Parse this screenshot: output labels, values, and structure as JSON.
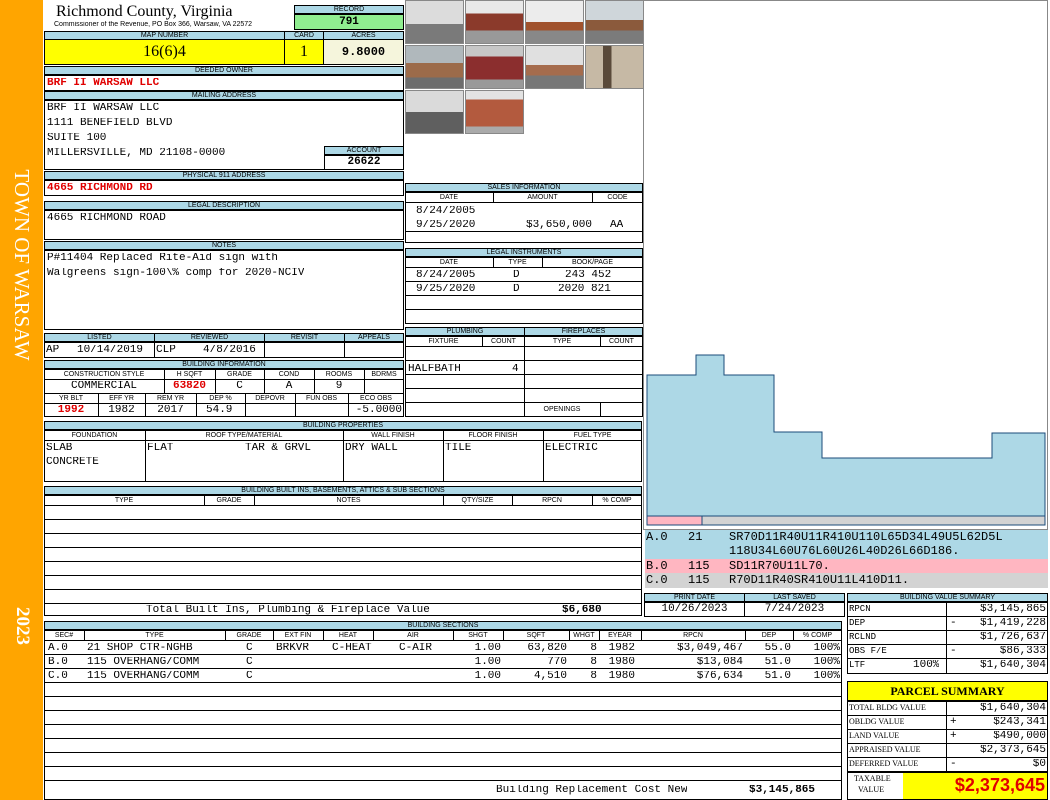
{
  "header": {
    "county": "Richmond County, Virginia",
    "commissioner": "Commissioner of the Revenue, PO Box 366, Warsaw, VA 22572",
    "record_label": "RECORD",
    "record": "791",
    "map_label": "MAP NUMBER",
    "map": "16(6)4",
    "card_label": "CARD",
    "card": "1",
    "acres_label": "ACRES",
    "acres": "9.8000"
  },
  "sidebar": {
    "town": "TOWN OF WARSAW",
    "year": "2023"
  },
  "owner": {
    "label": "DEEDED OWNER",
    "name": "BRF II WARSAW LLC"
  },
  "mailing": {
    "label": "MAILING ADDRESS",
    "lines": [
      "BRF II WARSAW LLC",
      "1111 BENEFIELD BLVD",
      "SUITE 100",
      "MILLERSVILLE, MD 21108-0000"
    ],
    "account_label": "ACCOUNT",
    "account": "26622"
  },
  "physical": {
    "label": "PHYSICAL 911 ADDRESS",
    "address": "4665 RICHMOND RD"
  },
  "legal": {
    "label": "LEGAL DESCRIPTION",
    "text": "4665 RICHMOND ROAD"
  },
  "notes": {
    "label": "NOTES",
    "lines": [
      "P#11404 Replaced Rite-Aid sign with",
      "Walgreens sign-100\\% comp for 2020-NCIV"
    ]
  },
  "listing": {
    "listed_label": "LISTED",
    "reviewed_label": "REVIEWED",
    "revisit_label": "REVISIT",
    "appeals_label": "APPEALS",
    "listed_by": "AP",
    "listed_date": "10/14/2019",
    "reviewed_by": "CLP",
    "reviewed_date": "4/8/2016"
  },
  "building": {
    "label": "BUILDING INFORMATION",
    "cols1": [
      "CONSTRUCTION STYLE",
      "H SQFT",
      "GRADE",
      "COND",
      "ROOMS",
      "BDRMS"
    ],
    "style": "COMMERCIAL",
    "hsqft": "63820",
    "grade": "C",
    "cond": "A",
    "rooms": "9",
    "bdrms": "",
    "cols2": [
      "YR BLT",
      "EFF YR",
      "REM YR",
      "DEP %",
      "DEPOVR",
      "FUN OBS",
      "ECO OBS"
    ],
    "yrblt": "1992",
    "effyr": "1982",
    "remyr": "2017",
    "dep": "54.9",
    "depovr": "",
    "funobs": "",
    "ecoobs": "-5.0000"
  },
  "properties": {
    "label": "BUILDING PROPERTIES",
    "cols": [
      "FOUNDATION",
      "ROOF TYPE/MATERIAL",
      "WALL FINISH",
      "FLOOR FINISH",
      "FUEL TYPE"
    ],
    "foundation": [
      "SLAB",
      "CONCRETE"
    ],
    "roof_type": "FLAT",
    "roof_material": "TAR & GRVL",
    "wall": "DRY WALL",
    "floor": "TILE",
    "fuel": "ELECTRIC"
  },
  "builtins": {
    "label": "BUILDING BUILT INS, BASEMENTS, ATTICS & SUB SECTIONS",
    "cols": [
      "TYPE",
      "GRADE",
      "NOTES",
      "QTY/SIZE",
      "RPCN",
      "% COMP"
    ],
    "total_label": "Total Built Ins, Plumbing & Fireplace Value",
    "total": "$6,680"
  },
  "sales": {
    "label": "SALES INFORMATION",
    "cols": [
      "DATE",
      "AMOUNT",
      "CODE"
    ],
    "rows": [
      {
        "date": "8/24/2005",
        "amount": "",
        "code": ""
      },
      {
        "date": "9/25/2020",
        "amount": "$3,650,000",
        "code": "AA"
      }
    ]
  },
  "instruments": {
    "label": "LEGAL INSTRUMENTS",
    "cols": [
      "DATE",
      "TYPE",
      "BOOK/PAGE"
    ],
    "rows": [
      {
        "date": "8/24/2005",
        "type": "D",
        "book": "243 452"
      },
      {
        "date": "9/25/2020",
        "type": "D",
        "book": "2020 821"
      }
    ]
  },
  "plumbing": {
    "label": "PLUMBING",
    "cols": [
      "FIXTURE",
      "COUNT"
    ],
    "rows": [
      {
        "fixture": "HALFBATH",
        "count": "4"
      }
    ]
  },
  "fireplaces": {
    "label": "FIREPLACES",
    "cols": [
      "TYPE",
      "COUNT"
    ],
    "openings_label": "OPENINGS"
  },
  "sketch": {
    "lines": [
      {
        "code": "A.0",
        "num": "21",
        "text": "SR70D11R40U11R410U110L65D34L49U5L62D5L",
        "text2": "118U34L60U76L60U26L40D26L66D186.",
        "color": "#add8e6"
      },
      {
        "code": "B.0",
        "num": "115",
        "text": "SD11R70U11L70.",
        "color": "#ffb6c1"
      },
      {
        "code": "C.0",
        "num": "115",
        "text": "R70D11R40SR410U11L410D11.",
        "color": "#d3d3d3"
      }
    ],
    "fill_color": "#add8e6"
  },
  "dates": {
    "print_label": "PRINT DATE",
    "print": "10/26/2023",
    "saved_label": "LAST SAVED",
    "saved": "7/24/2023"
  },
  "value_summary": {
    "label": "BUILDING VALUE SUMMARY",
    "rows": [
      {
        "label": "RPCN",
        "sign": "",
        "pct": "",
        "value": "$3,145,865"
      },
      {
        "label": "DEP",
        "sign": "-",
        "pct": "",
        "value": "$1,419,228"
      },
      {
        "label": "RCLND",
        "sign": "",
        "pct": "",
        "value": "$1,726,637"
      },
      {
        "label": "OBS F/E",
        "sign": "-",
        "pct": "",
        "value": "$86,333"
      },
      {
        "label": "LTF",
        "sign": "",
        "pct": "100%",
        "value": "$1,640,304"
      }
    ]
  },
  "sections": {
    "label": "BUILDING SECTIONS",
    "cols": [
      "SEC#",
      "TYPE",
      "GRADE",
      "EXT FIN",
      "HEAT",
      "AIR",
      "SHGT",
      "SQFT",
      "WHGT",
      "EYEAR",
      "RPCN",
      "DEP",
      "% COMP"
    ],
    "rows": [
      {
        "sec": "A.0",
        "type": "21 SHOP CTR-NGHB",
        "grade": "C",
        "ext": "BRKVR",
        "heat": "C-HEAT",
        "air": "C-AIR",
        "shgt": "1.00",
        "sqft": "63,820",
        "whgt": "8",
        "eyear": "1982",
        "rpcn": "$3,049,467",
        "dep": "55.0",
        "comp": "100%"
      },
      {
        "sec": "B.0",
        "type": "115 OVERHANG/COMM",
        "grade": "C",
        "ext": "",
        "heat": "",
        "air": "",
        "shgt": "1.00",
        "sqft": "770",
        "whgt": "8",
        "eyear": "1980",
        "rpcn": "$13,084",
        "dep": "51.0",
        "comp": "100%"
      },
      {
        "sec": "C.0",
        "type": "115 OVERHANG/COMM",
        "grade": "C",
        "ext": "",
        "heat": "",
        "air": "",
        "shgt": "1.00",
        "sqft": "4,510",
        "whgt": "8",
        "eyear": "1980",
        "rpcn": "$76,634",
        "dep": "51.0",
        "comp": "100%"
      }
    ],
    "replacement_label": "Building Replacement Cost New",
    "replacement": "$3,145,865"
  },
  "parcel": {
    "label": "PARCEL SUMMARY",
    "rows": [
      {
        "label": "TOTAL BLDG VALUE",
        "sign": "",
        "value": "$1,640,304"
      },
      {
        "label": "OBLDG VALUE",
        "sign": "+",
        "value": "$243,341"
      },
      {
        "label": "LAND VALUE",
        "sign": "+",
        "value": "$490,000"
      },
      {
        "label": "APPRAISED VALUE",
        "sign": "",
        "value": "$2,373,645"
      },
      {
        "label": "DEFERRED VALUE",
        "sign": "-",
        "value": "$0"
      }
    ],
    "taxable_label1": "TAXABLE",
    "taxable_label2": "VALUE",
    "taxable": "$2,373,645"
  }
}
